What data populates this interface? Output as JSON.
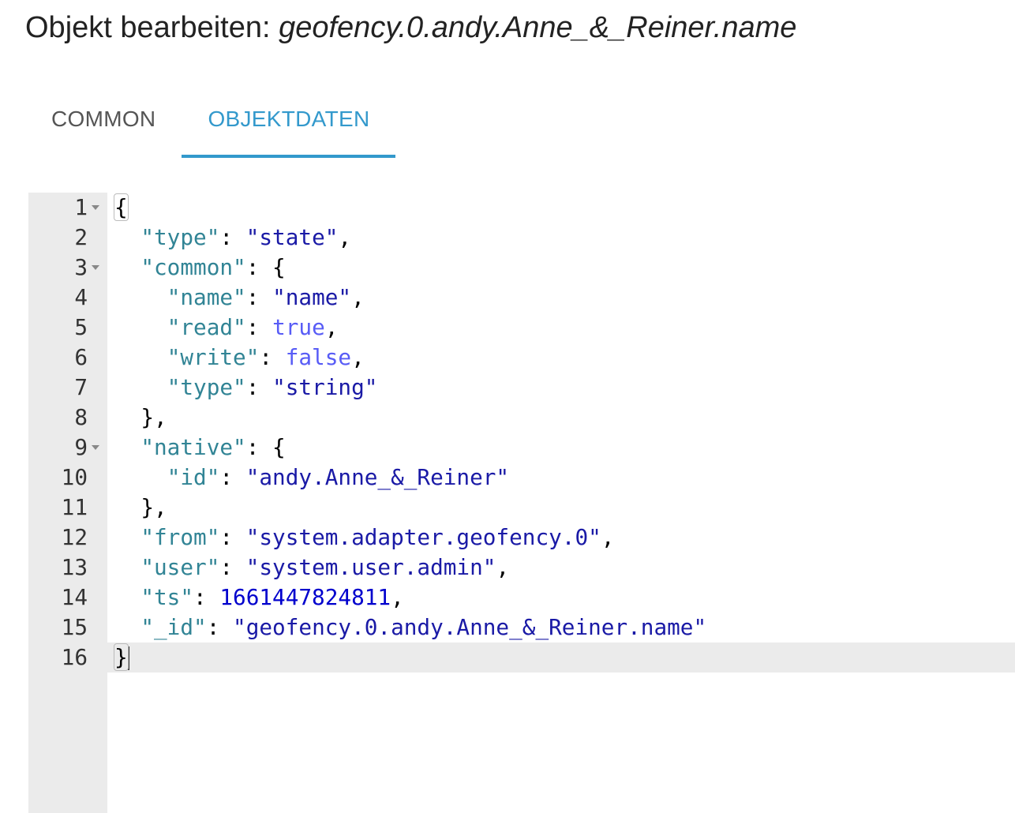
{
  "header": {
    "title_prefix": "Objekt bearbeiten: ",
    "title_object": "geofency.0.andy.Anne_&_Reiner.name"
  },
  "tabs": [
    {
      "label": "COMMON",
      "active": false
    },
    {
      "label": "OBJEKTDATEN",
      "active": true
    }
  ],
  "colors": {
    "accent": "#3399cc",
    "key": "#318495",
    "string": "#1a1aa6",
    "boolean": "#585cf6",
    "number": "#0000cd"
  },
  "editor": {
    "active_line": 16,
    "lines": [
      {
        "n": "1",
        "fold": true,
        "t": [
          [
            "p",
            "{"
          ]
        ]
      },
      {
        "n": "2",
        "t": [
          [
            "p",
            "  "
          ],
          [
            "k",
            "\"type\""
          ],
          [
            "p",
            ": "
          ],
          [
            "s",
            "\"state\""
          ],
          [
            "p",
            ","
          ]
        ]
      },
      {
        "n": "3",
        "fold": true,
        "t": [
          [
            "p",
            "  "
          ],
          [
            "k",
            "\"common\""
          ],
          [
            "p",
            ": {"
          ]
        ]
      },
      {
        "n": "4",
        "t": [
          [
            "p",
            "    "
          ],
          [
            "k",
            "\"name\""
          ],
          [
            "p",
            ": "
          ],
          [
            "s",
            "\"name\""
          ],
          [
            "p",
            ","
          ]
        ]
      },
      {
        "n": "5",
        "t": [
          [
            "p",
            "    "
          ],
          [
            "k",
            "\"read\""
          ],
          [
            "p",
            ": "
          ],
          [
            "b",
            "true"
          ],
          [
            "p",
            ","
          ]
        ]
      },
      {
        "n": "6",
        "t": [
          [
            "p",
            "    "
          ],
          [
            "k",
            "\"write\""
          ],
          [
            "p",
            ": "
          ],
          [
            "b",
            "false"
          ],
          [
            "p",
            ","
          ]
        ]
      },
      {
        "n": "7",
        "t": [
          [
            "p",
            "    "
          ],
          [
            "k",
            "\"type\""
          ],
          [
            "p",
            ": "
          ],
          [
            "s",
            "\"string\""
          ]
        ]
      },
      {
        "n": "8",
        "t": [
          [
            "p",
            "  },"
          ]
        ]
      },
      {
        "n": "9",
        "fold": true,
        "t": [
          [
            "p",
            "  "
          ],
          [
            "k",
            "\"native\""
          ],
          [
            "p",
            ": {"
          ]
        ]
      },
      {
        "n": "10",
        "t": [
          [
            "p",
            "    "
          ],
          [
            "k",
            "\"id\""
          ],
          [
            "p",
            ": "
          ],
          [
            "s",
            "\"andy.Anne_&_Reiner\""
          ]
        ]
      },
      {
        "n": "11",
        "t": [
          [
            "p",
            "  },"
          ]
        ]
      },
      {
        "n": "12",
        "t": [
          [
            "p",
            "  "
          ],
          [
            "k",
            "\"from\""
          ],
          [
            "p",
            ": "
          ],
          [
            "s",
            "\"system.adapter.geofency.0\""
          ],
          [
            "p",
            ","
          ]
        ]
      },
      {
        "n": "13",
        "t": [
          [
            "p",
            "  "
          ],
          [
            "k",
            "\"user\""
          ],
          [
            "p",
            ": "
          ],
          [
            "s",
            "\"system.user.admin\""
          ],
          [
            "p",
            ","
          ]
        ]
      },
      {
        "n": "14",
        "t": [
          [
            "p",
            "  "
          ],
          [
            "k",
            "\"ts\""
          ],
          [
            "p",
            ": "
          ],
          [
            "n",
            "1661447824811"
          ],
          [
            "p",
            ","
          ]
        ]
      },
      {
        "n": "15",
        "t": [
          [
            "p",
            "  "
          ],
          [
            "k",
            "\"_id\""
          ],
          [
            "p",
            ": "
          ],
          [
            "s",
            "\"geofency.0.andy.Anne_&_Reiner.name\""
          ]
        ]
      },
      {
        "n": "16",
        "t": [
          [
            "p",
            "}"
          ]
        ]
      }
    ]
  }
}
